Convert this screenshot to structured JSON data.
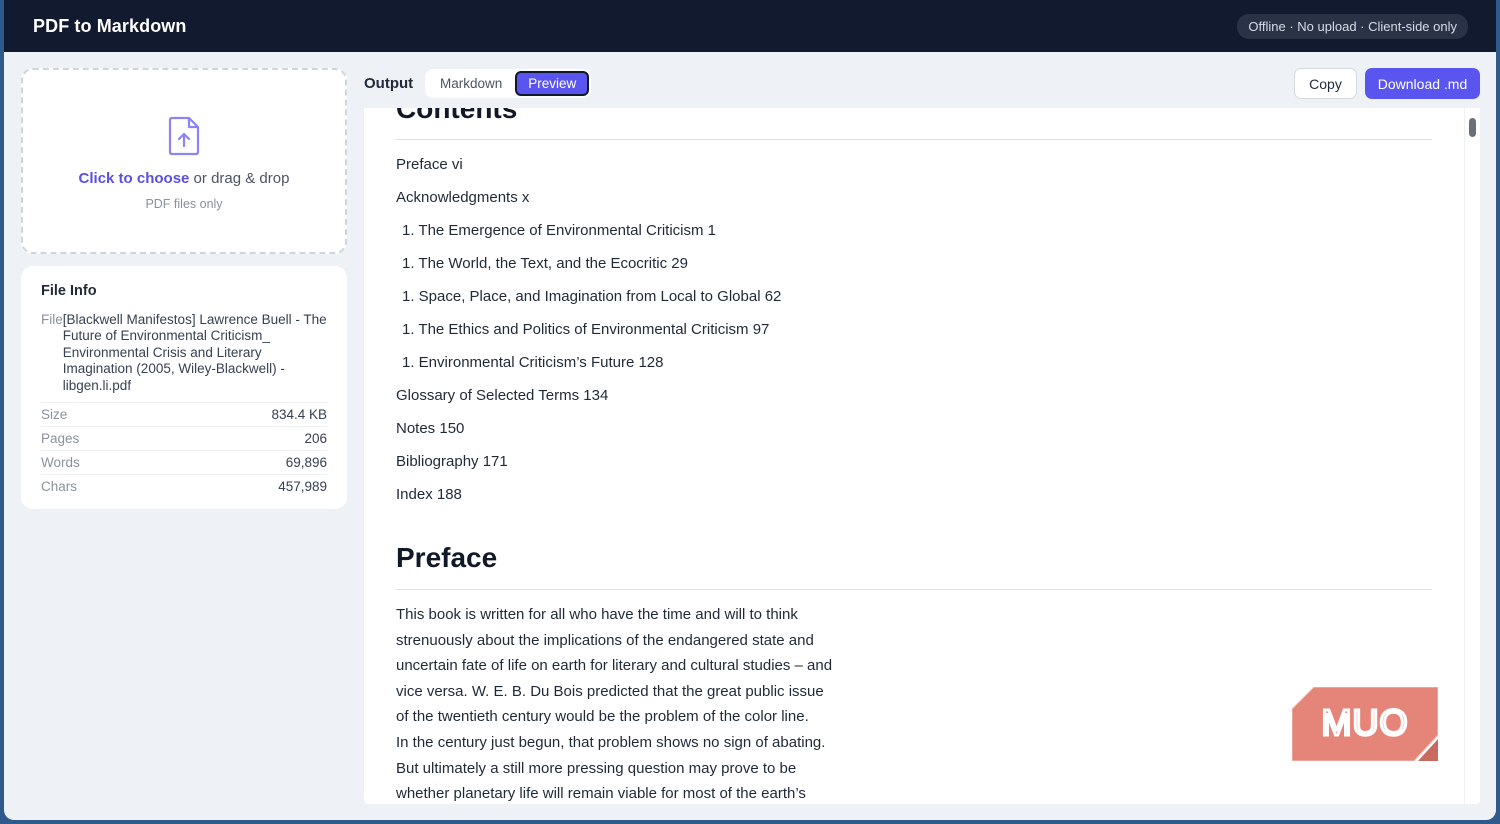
{
  "app": {
    "title": "PDF to Markdown",
    "status": "Offline · No upload · Client-side only"
  },
  "dropzone": {
    "link_text": "Click to choose",
    "rest_text": " or drag & drop",
    "sub_text": "PDF files only"
  },
  "file_info": {
    "title": "File Info",
    "file_label": "File",
    "file_value": "[Blackwell Manifestos] Lawrence Buell - The Future of Environmental Criticism_ Environmental Crisis and Literary Imagination (2005, Wiley-Blackwell) - libgen.li.pdf",
    "rows": [
      {
        "label": "Size",
        "value": "834.4 KB"
      },
      {
        "label": "Pages",
        "value": "206"
      },
      {
        "label": "Words",
        "value": "69,896"
      },
      {
        "label": "Chars",
        "value": "457,989"
      }
    ]
  },
  "output": {
    "label": "Output",
    "tabs": [
      {
        "label": "Markdown",
        "active": false
      },
      {
        "label": "Preview",
        "active": true
      }
    ],
    "copy_label": "Copy",
    "download_label": "Download .md"
  },
  "preview": {
    "contents_heading": "Contents",
    "toc": [
      "Preface vi",
      "Acknowledgments x"
    ],
    "numbered": [
      "1. The Emergence of Environmental Criticism 1",
      "1. The World, the Text, and the Ecocritic 29",
      "1. Space, Place, and Imagination from Local to Global 62",
      "1. The Ethics and Politics of Environmental Criticism 97",
      "1. Environmental Criticism’s Future 128"
    ],
    "toc_after": [
      "Glossary of Selected Terms 134",
      "Notes 150",
      "Bibliography 171",
      "Index 188"
    ],
    "preface_heading": "Preface",
    "preface_lines": [
      "This book is written for all who have the time and will to think",
      "strenuously about the implications of the endangered state and",
      "uncertain fate of life on earth for literary and cultural studies – and",
      "vice versa. W. E. B. Du Bois predicted that the great public issue",
      "of the twentieth century would be the problem of the color line.",
      "In the century just begun, that problem shows no sign of abating.",
      "But ultimately a still more pressing question may prove to be",
      "whether planetary life will remain viable for most of the earth’s"
    ]
  },
  "watermark": {
    "text": "MUO",
    "color": "#e58579"
  },
  "colors": {
    "accent": "#5b55ef",
    "topbar": "#111a2e"
  }
}
